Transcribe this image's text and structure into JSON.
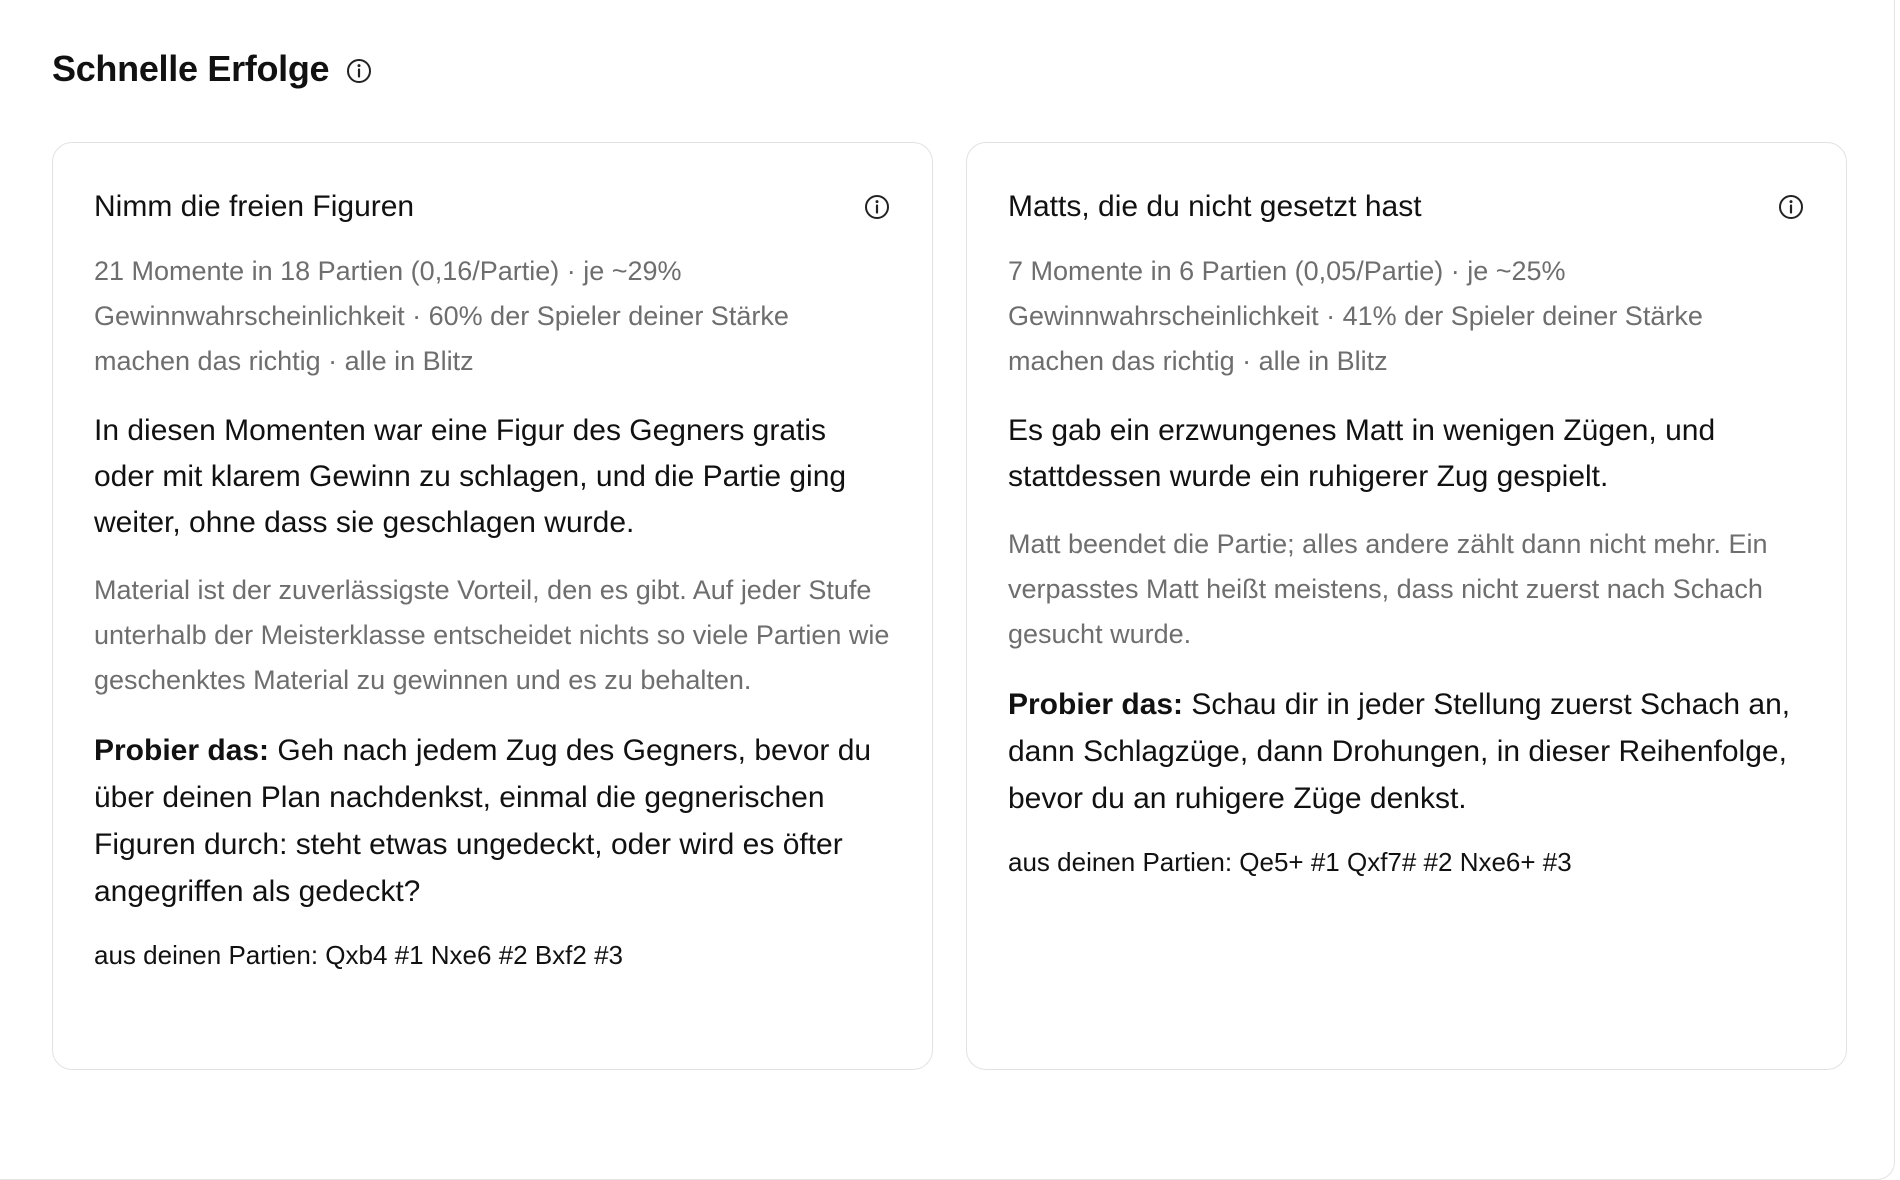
{
  "section": {
    "title": "Schnelle Erfolge",
    "info_icon": "info-icon"
  },
  "cards": [
    {
      "title": "Nimm die freien Figuren",
      "stats": "21 Momente in 18 Partien (0,16/Partie) · je ~29% Gewinnwahrscheinlichkeit · 60% der Spieler deiner Stärke machen das richtig · alle in Blitz",
      "description": "In diesen Momenten war eine Figur des Gegners gratis oder mit klarem Gewinn zu schlagen, und die Partie ging weiter, ohne dass sie geschlagen wurde.",
      "note": "Material ist der zuverlässigste Vorteil, den es gibt. Auf jeder Stufe unterhalb der Meisterklasse entscheidet nichts so viele Partien wie geschenktes Material zu gewinnen und es zu behalten.",
      "tip_label": "Probier das:",
      "tip_text": "Geh nach jedem Zug des Gegners, bevor du über deinen Plan nachdenkst, einmal die gegnerischen Figuren durch: steht etwas ungedeckt, oder wird es öfter angegriffen als gedeckt?",
      "games": "aus deinen Partien: Qxb4 #1 Nxe6 #2 Bxf2 #3"
    },
    {
      "title": "Matts, die du nicht gesetzt hast",
      "stats": "7 Momente in 6 Partien (0,05/Partie) · je ~25% Gewinnwahrscheinlichkeit · 41% der Spieler deiner Stärke machen das richtig · alle in Blitz",
      "description": "Es gab ein erzwungenes Matt in wenigen Zügen, und stattdessen wurde ein ruhigerer Zug gespielt.",
      "note": "Matt beendet die Partie; alles andere zählt dann nicht mehr. Ein verpasstes Matt heißt meistens, dass nicht zuerst nach Schach gesucht wurde.",
      "tip_label": "Probier das:",
      "tip_text": "Schau dir in jeder Stellung zuerst Schach an, dann Schlagzüge, dann Drohungen, in dieser Reihenfolge, bevor du an ruhigere Züge denkst.",
      "games": "aus deinen Partien: Qe5+ #1 Qxf7# #2 Nxe6+ #3"
    }
  ]
}
